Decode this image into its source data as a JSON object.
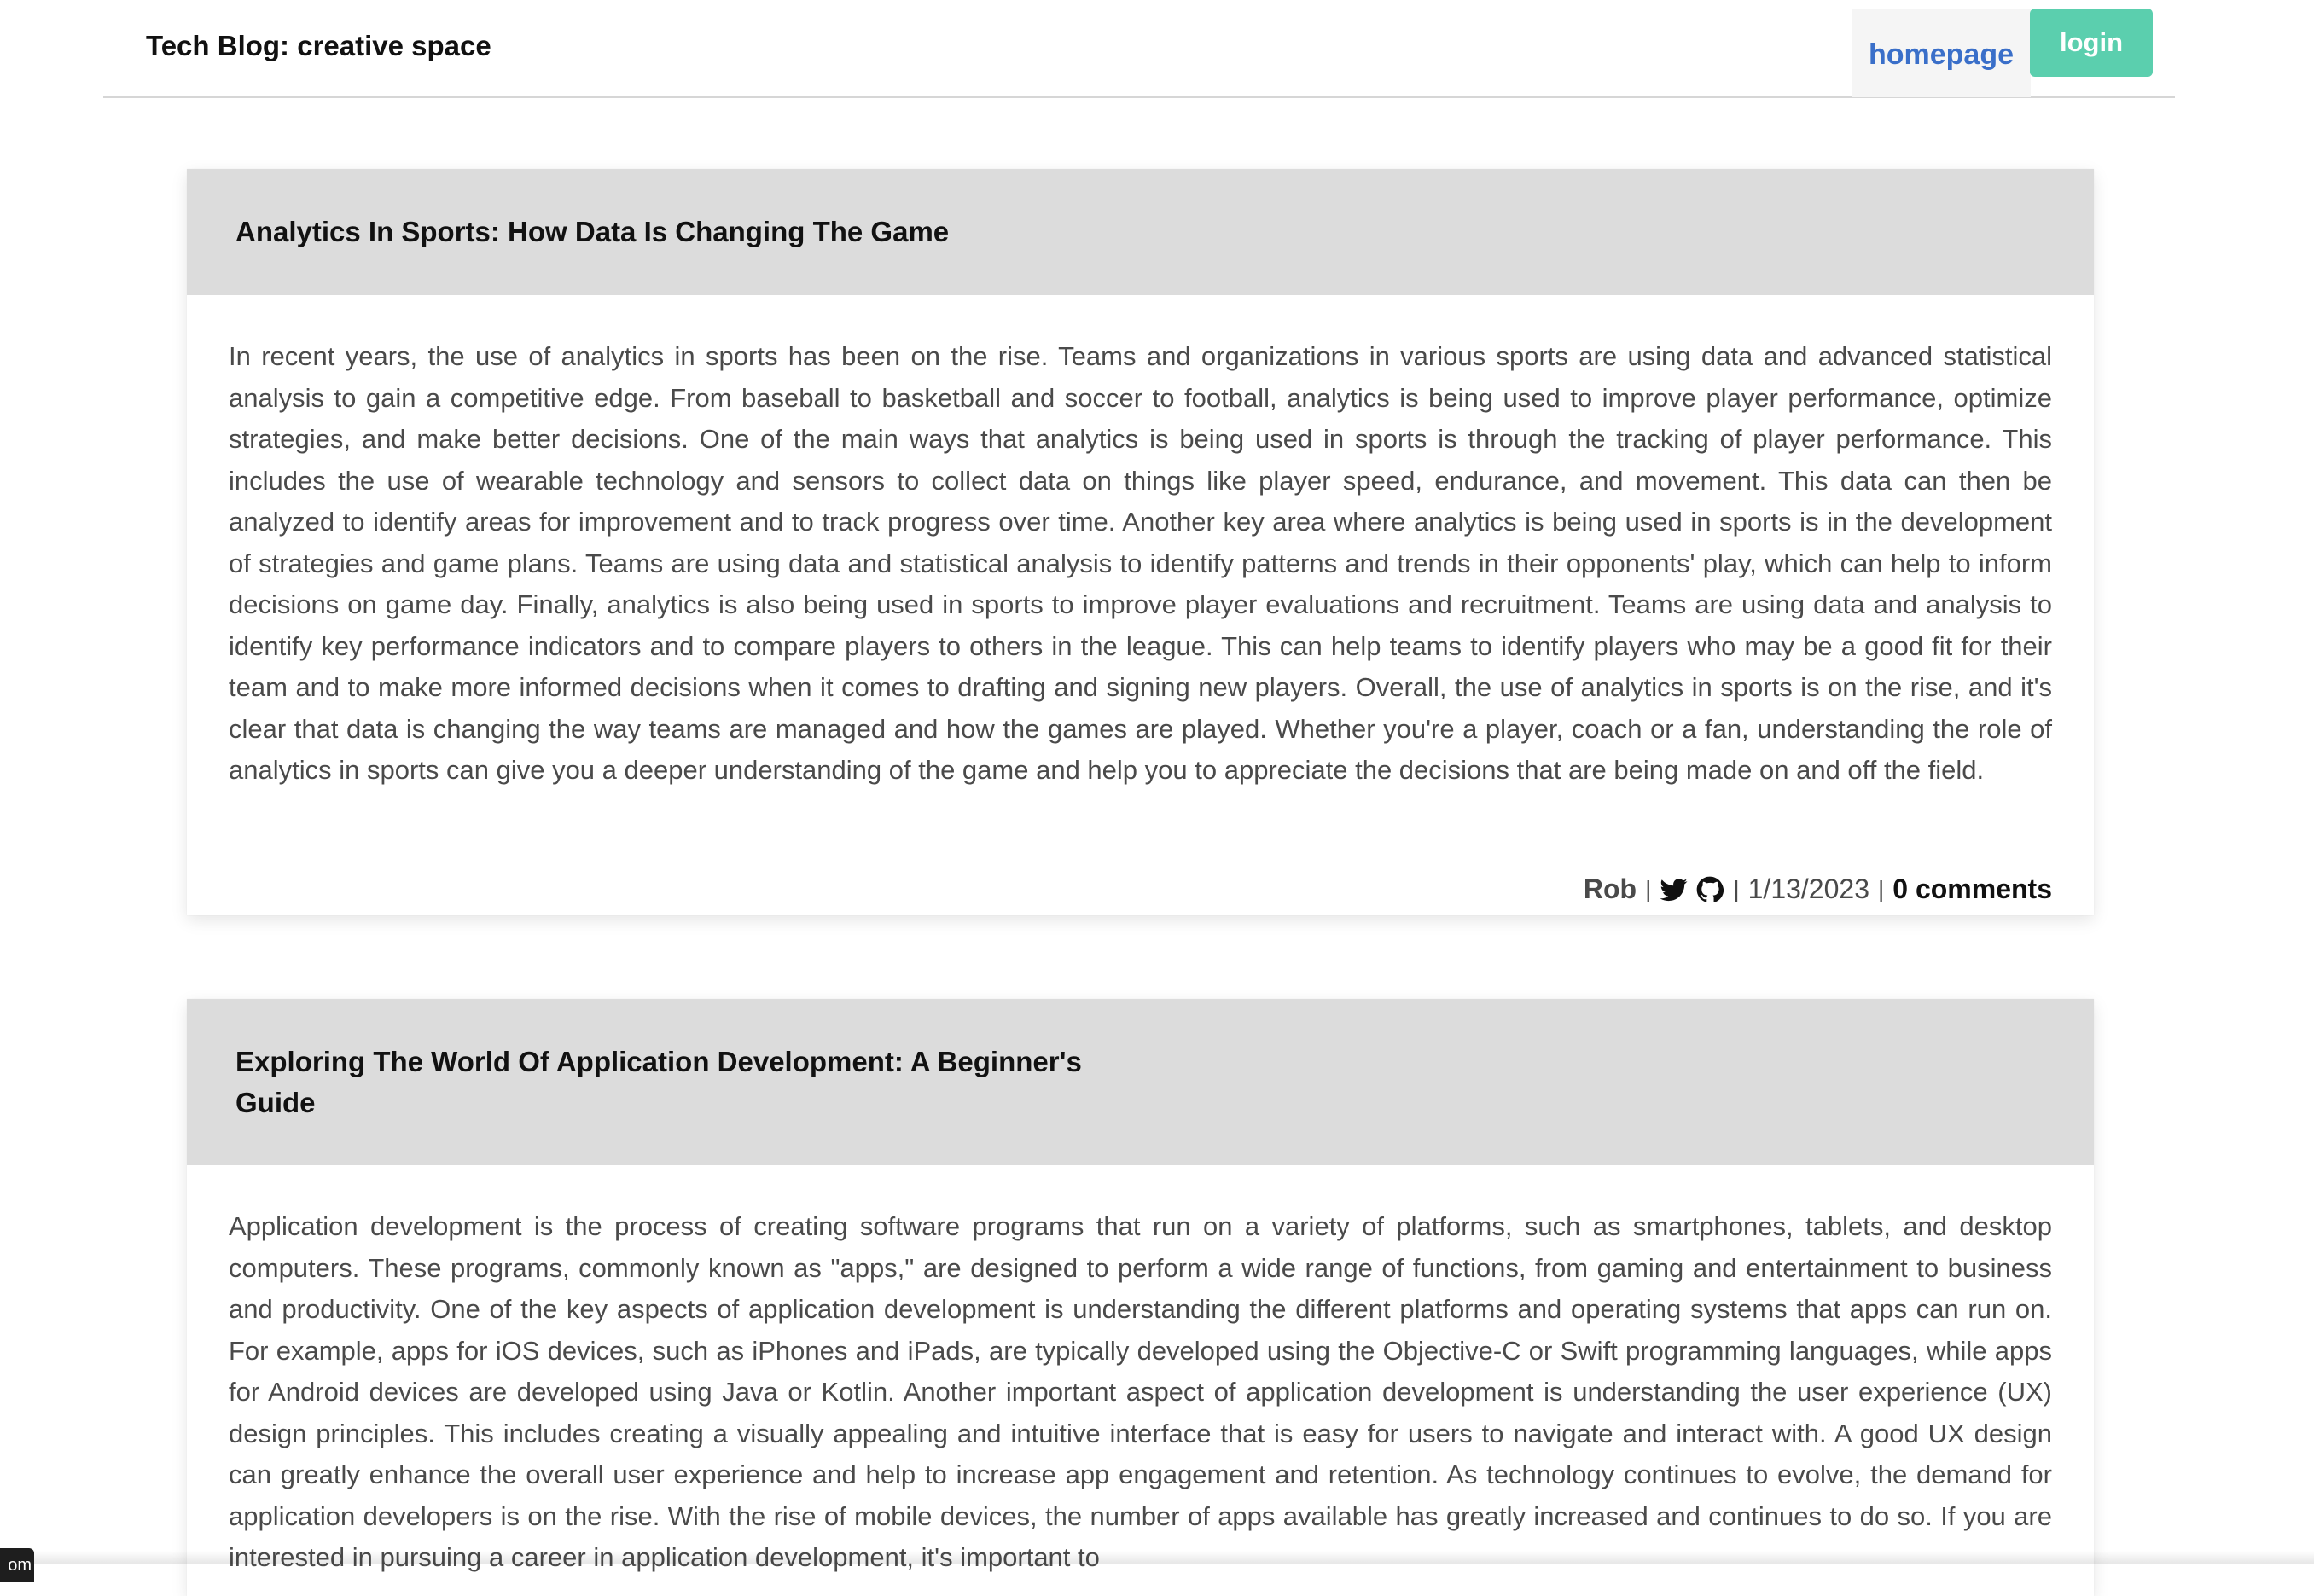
{
  "header": {
    "site_title": "Tech Blog: creative space",
    "nav_home": "homepage",
    "nav_login": "login"
  },
  "posts": [
    {
      "title": "Analytics In Sports: How Data Is Changing The Game",
      "body": "In recent years, the use of analytics in sports has been on the rise. Teams and organizations in various sports are using data and advanced statistical analysis to gain a competitive edge. From baseball to basketball and soccer to football, analytics is being used to improve player performance, optimize strategies, and make better decisions. One of the main ways that analytics is being used in sports is through the tracking of player performance. This includes the use of wearable technology and sensors to collect data on things like player speed, endurance, and movement. This data can then be analyzed to identify areas for improvement and to track progress over time. Another key area where analytics is being used in sports is in the development of strategies and game plans. Teams are using data and statistical analysis to identify patterns and trends in their opponents' play, which can help to inform decisions on game day. Finally, analytics is also being used in sports to improve player evaluations and recruitment. Teams are using data and analysis to identify key performance indicators and to compare players to others in the league. This can help teams to identify players who may be a good fit for their team and to make more informed decisions when it comes to drafting and signing new players. Overall, the use of analytics in sports is on the rise, and it's clear that data is changing the way teams are managed and how the games are played. Whether you're a player, coach or a fan, understanding the role of analytics in sports can give you a deeper understanding of the game and help you to appreciate the decisions that are being made on and off the field.",
      "author": "Rob",
      "separator": "|",
      "date": "1/13/2023",
      "comments": "0 comments"
    },
    {
      "title": "Exploring The World Of Application Development: A Beginner's Guide",
      "body": "Application development is the process of creating software programs that run on a variety of platforms, such as smartphones, tablets, and desktop computers. These programs, commonly known as \"apps,\" are designed to perform a wide range of functions, from gaming and entertainment to business and productivity. One of the key aspects of application development is understanding the different platforms and operating systems that apps can run on. For example, apps for iOS devices, such as iPhones and iPads, are typically developed using the Objective-C or Swift programming languages, while apps for Android devices are developed using Java or Kotlin. Another important aspect of application development is understanding the user experience (UX) design principles. This includes creating a visually appealing and intuitive interface that is easy for users to navigate and interact with. A good UX design can greatly enhance the overall user experience and help to increase app engagement and retention. As technology continues to evolve, the demand for application developers is on the rise. With the rise of mobile devices, the number of apps available has greatly increased and continues to do so. If you are interested in pursuing a career in application development, it's important to"
    }
  ],
  "icons": {
    "twitter": "twitter-icon",
    "github": "github-icon"
  },
  "corner_tag": "om",
  "colors": {
    "login_bg": "#5bcfae",
    "home_link": "#3a6fc9",
    "card_header_bg": "#dcdcdc"
  }
}
